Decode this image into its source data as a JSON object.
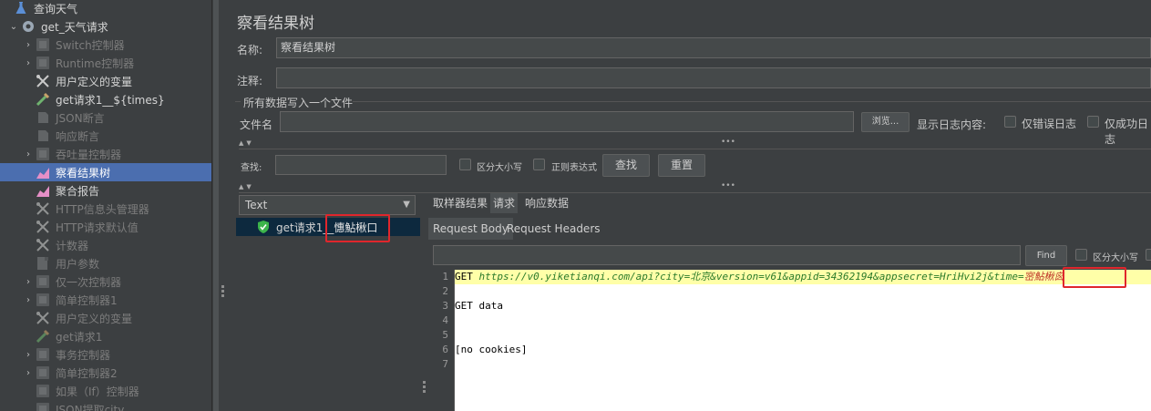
{
  "tree": {
    "items": [
      {
        "label": "查询天气",
        "icon": "flask-icon",
        "chevron": "",
        "indent": 0,
        "state": "active"
      },
      {
        "label": "get_天气请求",
        "icon": "gear-icon",
        "chevron": "⌄",
        "indent": 1,
        "state": "active"
      },
      {
        "label": "Switch控制器",
        "icon": "controller-icon",
        "chevron": "›",
        "indent": 2,
        "state": "disabled"
      },
      {
        "label": "Runtime控制器",
        "icon": "controller-icon",
        "chevron": "›",
        "indent": 2,
        "state": "disabled"
      },
      {
        "label": "用户定义的变量",
        "icon": "wrench-icon",
        "chevron": "",
        "indent": 2,
        "state": "active"
      },
      {
        "label": "get请求1__${times}",
        "icon": "pipette-icon",
        "chevron": "",
        "indent": 2,
        "state": "active"
      },
      {
        "label": "JSON断言",
        "icon": "assertion-icon",
        "chevron": "",
        "indent": 2,
        "state": "disabled"
      },
      {
        "label": "响应断言",
        "icon": "assertion-icon",
        "chevron": "",
        "indent": 2,
        "state": "disabled"
      },
      {
        "label": "吞吐量控制器",
        "icon": "controller-icon",
        "chevron": "›",
        "indent": 2,
        "state": "disabled"
      },
      {
        "label": "察看结果树",
        "icon": "chart-icon",
        "chevron": "",
        "indent": 2,
        "state": "selected"
      },
      {
        "label": "聚合报告",
        "icon": "chart-icon",
        "chevron": "",
        "indent": 2,
        "state": "active"
      },
      {
        "label": "HTTP信息头管理器",
        "icon": "wrench-icon",
        "chevron": "",
        "indent": 2,
        "state": "disabled"
      },
      {
        "label": "HTTP请求默认值",
        "icon": "wrench-icon",
        "chevron": "",
        "indent": 2,
        "state": "disabled"
      },
      {
        "label": "计数器",
        "icon": "wrench-icon",
        "chevron": "",
        "indent": 2,
        "state": "disabled"
      },
      {
        "label": "用户参数",
        "icon": "preprocessor-icon",
        "chevron": "",
        "indent": 2,
        "state": "disabled"
      },
      {
        "label": "仅一次控制器",
        "icon": "controller-icon",
        "chevron": "›",
        "indent": 2,
        "state": "disabled"
      },
      {
        "label": "简单控制器1",
        "icon": "controller-icon",
        "chevron": "›",
        "indent": 2,
        "state": "disabled"
      },
      {
        "label": "用户定义的变量",
        "icon": "wrench-icon",
        "chevron": "",
        "indent": 2,
        "state": "disabled"
      },
      {
        "label": "get请求1",
        "icon": "pipette-icon",
        "chevron": "",
        "indent": 2,
        "state": "disabled"
      },
      {
        "label": "事务控制器",
        "icon": "controller-icon",
        "chevron": "›",
        "indent": 2,
        "state": "disabled"
      },
      {
        "label": "简单控制器2",
        "icon": "controller-icon",
        "chevron": "›",
        "indent": 2,
        "state": "disabled"
      },
      {
        "label": "如果（If）控制器",
        "icon": "controller-icon",
        "chevron": "",
        "indent": 2,
        "state": "disabled"
      },
      {
        "label": "JSON提取city",
        "icon": "controller-icon",
        "chevron": "",
        "indent": 2,
        "state": "disabled"
      }
    ]
  },
  "panel": {
    "title": "察看结果树",
    "name_label": "名称:",
    "name_value": "察看结果树",
    "comment_label": "注释:",
    "comment_value": "",
    "file_group_label": "所有数据写入一个文件",
    "filename_label": "文件名",
    "filename_value": "",
    "browse_button": "浏览...",
    "log_label": "显示日志内容:",
    "errors_only_label": "仅错误日志",
    "success_only_label": "仅成功日志"
  },
  "search": {
    "label": "查找:",
    "value": "",
    "case_sensitive_label": "区分大小写",
    "regex_label": "正则表达式",
    "search_button": "查找",
    "reset_button": "重置"
  },
  "results": {
    "renderer": "Text",
    "sample_label": "get请求1__",
    "sample_garbled": "憓鮎楸口",
    "tabs": [
      "取样器结果",
      "请求",
      "响应数据"
    ],
    "active_tab": 1,
    "subtabs": [
      "Request Body",
      "Request Headers"
    ],
    "active_subtab": 0,
    "find_value": "",
    "find_button": "Find",
    "find_case_label": "区分大小写"
  },
  "request_body": {
    "line_numbers": [
      "1",
      "2",
      "3",
      "4",
      "5",
      "6",
      "7"
    ],
    "line1_method": "GET ",
    "line1_url": "https://v0.yiketianqi.com/api?city=北京&version=v61&appid=34362194&appsecret=HriHvi2j&time=",
    "line1_garbled": "宻鮎楸囪",
    "line3": "GET data",
    "line6": "[no cookies]"
  },
  "colors": {
    "background": "#3c3f41",
    "selection": "#4b6eaf",
    "highlight_line": "#ffffa8",
    "annotation_red": "#e0262c"
  }
}
